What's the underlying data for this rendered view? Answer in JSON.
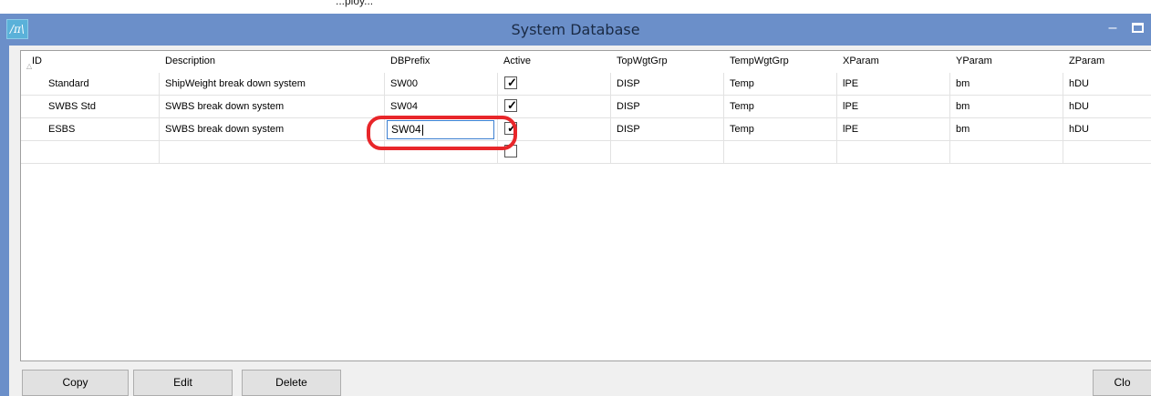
{
  "top_strip_text": "...ploy...",
  "window": {
    "title": "System Database",
    "minimize_glyph": "–",
    "app_icon_glyph": "/π\\"
  },
  "columns": [
    "ID",
    "Description",
    "DBPrefix",
    "Active",
    "TopWgtGrp",
    "TempWgtGrp",
    "XParam",
    "YParam",
    "ZParam"
  ],
  "rows": [
    {
      "id": "Standard",
      "description": "ShipWeight break down system",
      "dbprefix": "SW00",
      "active": true,
      "topwgtgrp": "DISP",
      "tempwgtgrp": "Temp",
      "xparam": "lPE",
      "yparam": "bm",
      "zparam": "hDU"
    },
    {
      "id": "SWBS Std",
      "description": "SWBS break down system",
      "dbprefix": "SW04",
      "active": true,
      "topwgtgrp": "DISP",
      "tempwgtgrp": "Temp",
      "xparam": "lPE",
      "yparam": "bm",
      "zparam": "hDU"
    },
    {
      "id": "ESBS",
      "description": "SWBS break down system",
      "dbprefix": "SW04",
      "active": true,
      "topwgtgrp": "DISP",
      "tempwgtgrp": "Temp",
      "xparam": "lPE",
      "yparam": "bm",
      "zparam": "hDU"
    },
    {
      "id": "",
      "description": "",
      "dbprefix": "",
      "active": false,
      "topwgtgrp": "",
      "tempwgtgrp": "",
      "xparam": "",
      "yparam": "",
      "zparam": ""
    }
  ],
  "editing": {
    "row": 2,
    "column": "dbprefix",
    "value": "SW04"
  },
  "buttons": {
    "copy": "Copy",
    "edit": "Edit",
    "delete": "Delete",
    "close": "Clo"
  },
  "colors": {
    "titlebar": "#6b8fc9",
    "highlight": "#e8262a",
    "input_border": "#3c7fd1"
  }
}
